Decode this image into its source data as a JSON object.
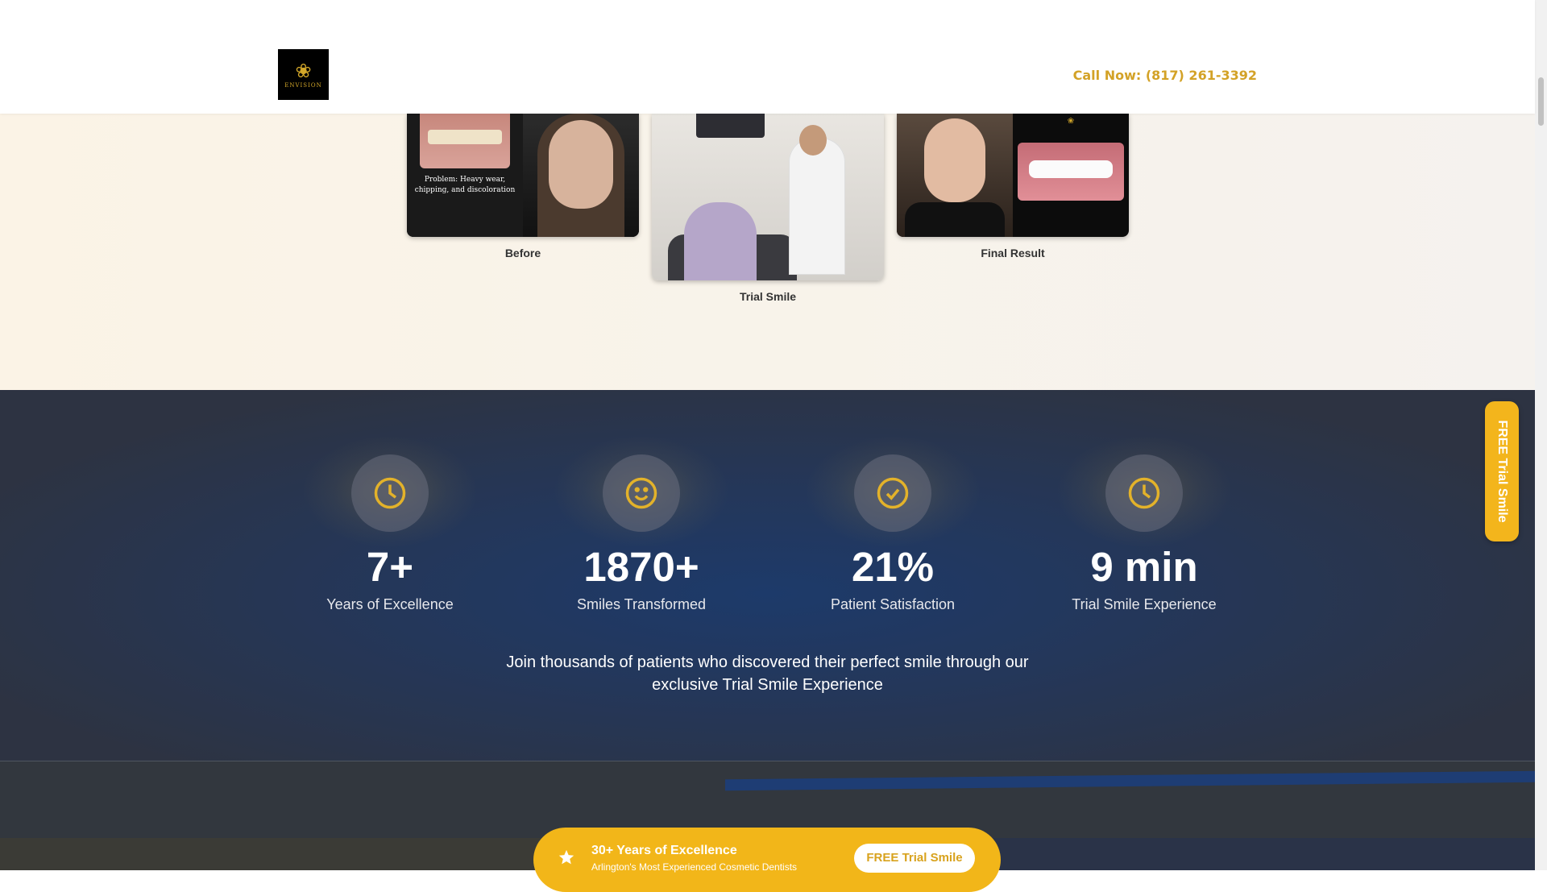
{
  "header": {
    "logo_text": "ENVISION",
    "call_label": "Call Now: (817) 261-3392"
  },
  "gallery": {
    "items": [
      {
        "caption": "Before",
        "problem_text": "Problem: Heavy wear, chipping, and discoloration"
      },
      {
        "caption": "Trial Smile"
      },
      {
        "caption": "Final Result"
      }
    ]
  },
  "stats": {
    "items": [
      {
        "icon": "clock-icon",
        "value": "7+",
        "label": "Years of Excellence"
      },
      {
        "icon": "smile-icon",
        "value": "1870+",
        "label": "Smiles Transformed"
      },
      {
        "icon": "check-circle-icon",
        "value": "21%",
        "label": "Patient Satisfaction"
      },
      {
        "icon": "clock-icon",
        "value": "9 min",
        "label": "Trial Smile Experience"
      }
    ],
    "description": "Join thousands of patients who discovered their perfect smile through our exclusive Trial Smile Experience"
  },
  "promo": {
    "title": "30+ Years of Excellence",
    "subtitle": "Arlington's Most Experienced Cosmetic Dentists",
    "button_label": "FREE Trial Smile"
  },
  "floating_tab": {
    "label": "FREE Trial Smile"
  },
  "colors": {
    "accent_gold": "#f2b619",
    "call_gold": "#d3a227",
    "stats_bg": "#24375a"
  }
}
